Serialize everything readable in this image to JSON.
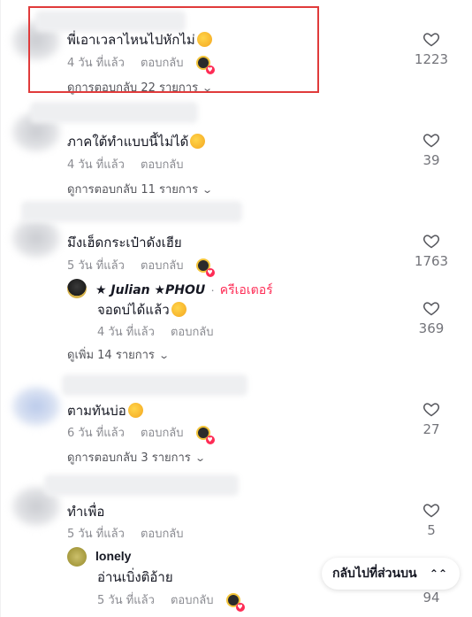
{
  "comments": [
    {
      "text": "พี่เอาเวลาไหนไปหักไม่",
      "time": "4 วัน ที่แล้ว",
      "reply_label": "ตอบกลับ",
      "creator_liked": true,
      "view_replies": "ดูการตอบกลับ 22 รายการ",
      "likes": "1223"
    },
    {
      "text": "ภาคใต้ทำแบบนี้ไม่ได้",
      "time": "4 วัน ที่แล้ว",
      "reply_label": "ตอบกลับ",
      "creator_liked": false,
      "view_replies": "ดูการตอบกลับ 11 รายการ",
      "likes": "39"
    },
    {
      "text": "มึงเฮ็ดกระเป๋าดังเฮีย",
      "time": "5 วัน ที่แล้ว",
      "reply_label": "ตอบกลับ",
      "creator_liked": true,
      "likes": "1763",
      "reply": {
        "name": "★ Julian ★PHOU",
        "separator": "·",
        "badge": "ครีเอเตอร์",
        "text": "จอดบ่ได้แล้ว",
        "time": "4 วัน ที่แล้ว",
        "reply_label": "ตอบกลับ",
        "likes": "369"
      },
      "view_more": "ดูเพิ่ม 14 รายการ"
    },
    {
      "text": "ตามทันบ่อ",
      "time": "6 วัน ที่แล้ว",
      "reply_label": "ตอบกลับ",
      "creator_liked": true,
      "view_replies": "ดูการตอบกลับ 3 รายการ",
      "likes": "27"
    },
    {
      "text": "ทำเพื่อ",
      "time": "5 วัน ที่แล้ว",
      "reply_label": "ตอบกลับ",
      "creator_liked": false,
      "likes": "5",
      "reply": {
        "name": "lonely",
        "text": "อ่านเบิ่งติอ้าย",
        "time": "5 วัน ที่แล้ว",
        "reply_label": "ตอบกลับ",
        "creator_liked": true,
        "likes": "94"
      }
    }
  ],
  "back_to_top": "กลับไปที่ส่วนบน",
  "colors": {
    "highlight": "#e03b3b",
    "accent": "#fe2c55",
    "muted": "#8a8b91"
  },
  "icons": {
    "like": "heart-outline-icon",
    "chevron": "chevron-down-icon",
    "back_top": "double-chevron-up-icon"
  }
}
